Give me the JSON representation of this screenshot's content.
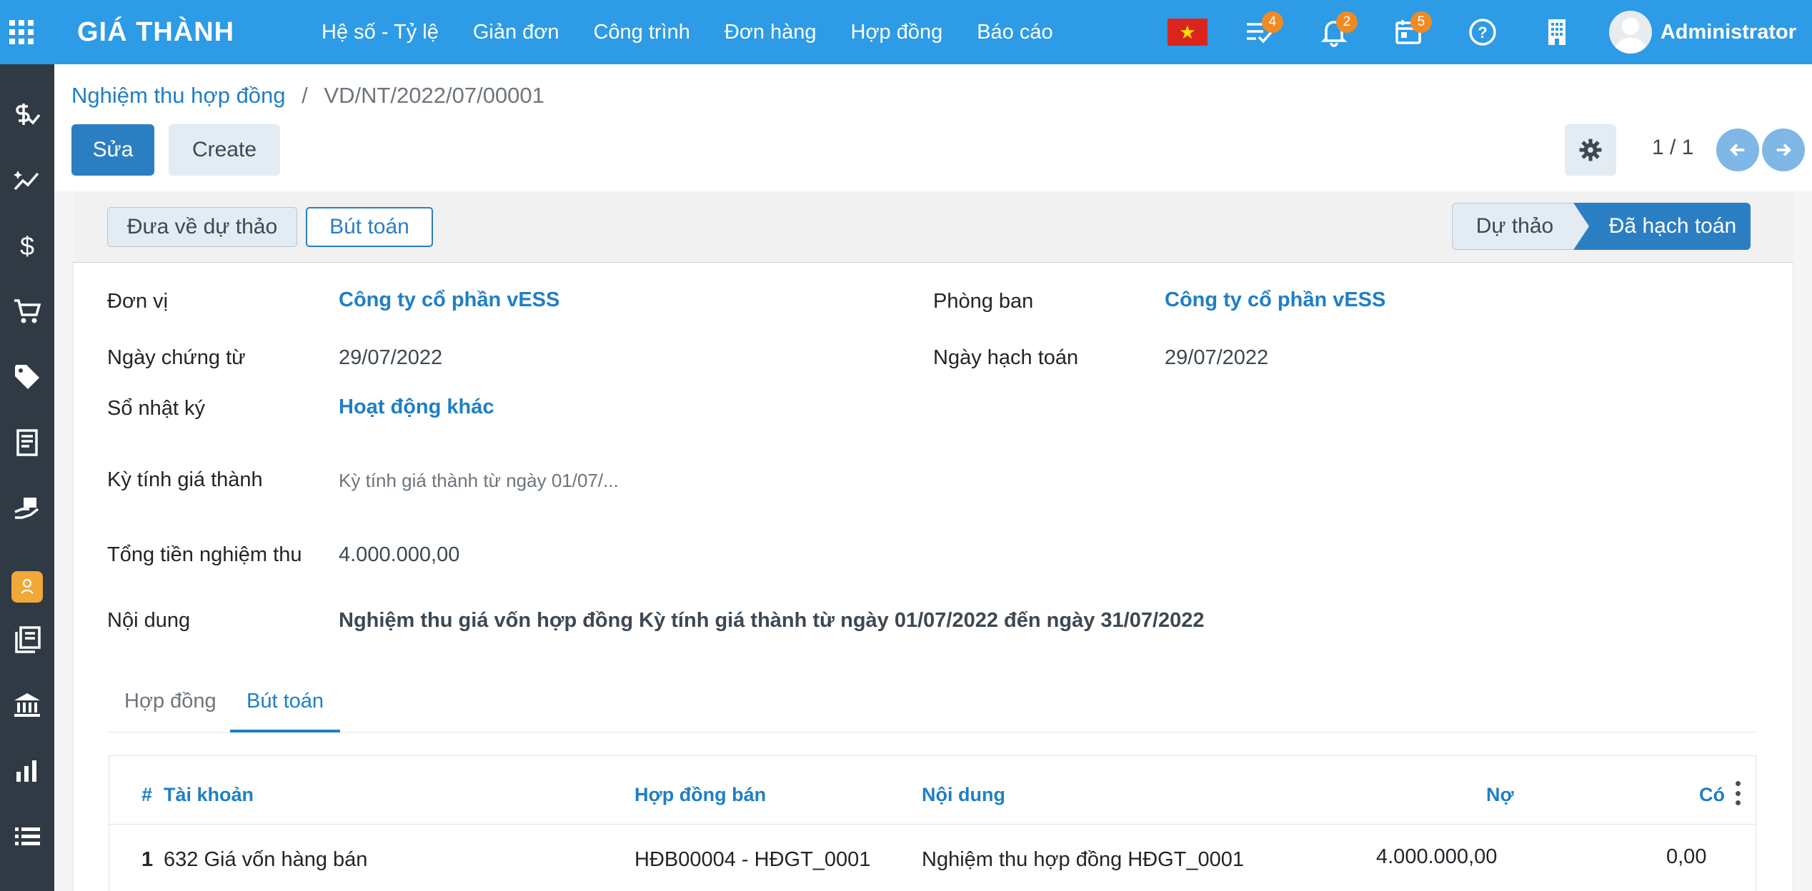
{
  "app": {
    "brand": "GIÁ THÀNH"
  },
  "menu": [
    {
      "label": "Hệ số - Tỷ lệ"
    },
    {
      "label": "Giản đơn"
    },
    {
      "label": "Công trình"
    },
    {
      "label": "Đơn hàng"
    },
    {
      "label": "Hợp đồng"
    },
    {
      "label": "Báo cáo"
    }
  ],
  "tools": {
    "activities_count": "4",
    "notifications_count": "2",
    "calendar_count": "5",
    "user_name": "Administrator"
  },
  "breadcrumb": {
    "parent": "Nghiệm thu hợp đồng",
    "separator": "/",
    "current": "VD/NT/2022/07/00001"
  },
  "actions": {
    "edit_label": "Sửa",
    "create_label": "Create"
  },
  "pager": {
    "value": "1 / 1"
  },
  "statusbar": {
    "reset_draft_label": "Đưa về dự thảo",
    "journal_entry_label": "Bút toán",
    "stages": [
      "Dự thảo",
      "Đã hạch toán"
    ],
    "active_stage": "Đã hạch toán"
  },
  "form": {
    "unit_label": "Đơn vị",
    "unit_value": "Công ty cổ phần vESS",
    "department_label": "Phòng ban",
    "department_value": "Công ty cổ phần vESS",
    "doc_date_label": "Ngày chứng từ",
    "doc_date_value": "29/07/2022",
    "post_date_label": "Ngày hạch toán",
    "post_date_value": "29/07/2022",
    "journal_label": "Sổ nhật ký",
    "journal_value": "Hoạt động khác",
    "period_label": "Kỳ tính giá thành",
    "period_value": "Kỳ tính giá thành từ ngày 01/07/...",
    "total_label": "Tổng tiền nghiệm thu",
    "total_value": "4.000.000,00",
    "content_label": "Nội dung",
    "content_value": "Nghiệm thu giá vốn hợp đồng Kỳ tính giá thành từ ngày 01/07/2022 đến ngày 31/07/2022"
  },
  "tabs": [
    {
      "label": "Hợp đồng",
      "active": false
    },
    {
      "label": "Bút toán",
      "active": true
    }
  ],
  "table": {
    "headers": {
      "index": "#",
      "account": "Tài khoản",
      "contract": "Hợp đồng bán",
      "content": "Nội dung",
      "debit": "Nợ",
      "credit": "Có"
    },
    "rows": [
      {
        "index": "1",
        "account": "632 Giá vốn hàng bán",
        "contract": "HĐB00004 - HĐGT_0001",
        "content": "Nghiệm thu hợp đồng HĐGT_0001",
        "debit": "4.000.000,00",
        "credit": "0,00"
      }
    ]
  },
  "colors": {
    "navbar": "#2d9be6",
    "primary": "#2c7ec3",
    "sidebar": "#2f3a45",
    "badge": "#f08a24"
  }
}
